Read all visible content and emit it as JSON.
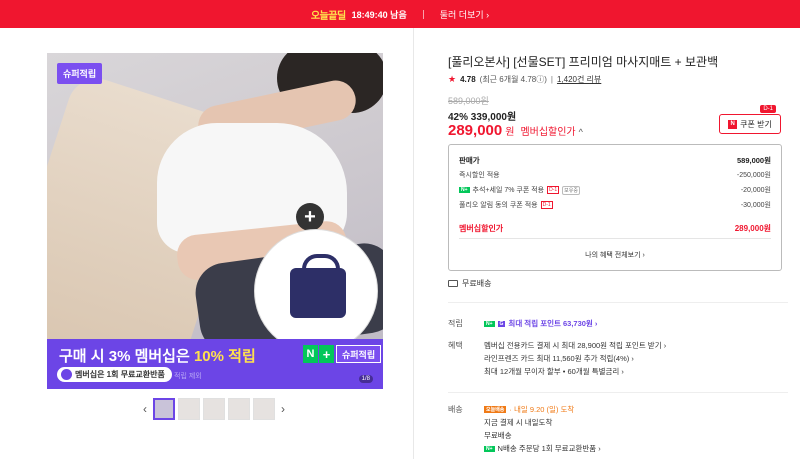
{
  "topbar": {
    "brand": "오늘끝딜",
    "time": "18:49:40 남음",
    "more": "둘러 더보기 ›"
  },
  "hero": {
    "tag": "슈퍼적립",
    "promo_headline_a": "구매 시 3% 멤버십은 ",
    "promo_headline_b": "10% 적립",
    "promo_sub": "멤버십은 1회 무료교환반품",
    "promo_faint": "적립 제외",
    "npay_label": "슈퍼적립",
    "counter": "1/8"
  },
  "thumbs": {
    "prev": "‹",
    "next": "›",
    "count": 5
  },
  "product": {
    "title": "[풀리오본사] [선물SET] 프리미엄 마사지매트 + 보관백",
    "rating_score": "4.78",
    "rating_detail": "(최근 6개월 4.78ⓘ)",
    "reviews": "1,420건 리뷰",
    "original_price": "589,000원",
    "discount_pct": "42%",
    "discount_price": "339,000원",
    "member_price": "289,000",
    "won": "원",
    "member_label": "멤버십할인가",
    "coupon": "쿠폰 받기",
    "coupon_tag": "D-1"
  },
  "price_box": {
    "sale_label": "판매가",
    "sale_value": "589,000원",
    "instant_label": "즉시할인 적용",
    "instant_value": "-250,000원",
    "extra_label": "추석+세일 7% 쿠폰 적용",
    "extra_tag": "D-1",
    "extra_tag2": "보유중",
    "extra_value": "-20,000원",
    "alarm_label": "풀리오 알림 동의 쿠폰 적용",
    "alarm_tag": "D-1",
    "alarm_value": "-30,000원",
    "member_label": "멤버십할인가",
    "member_value": "289,000원",
    "view_all": "나의 혜택 전체보기 ›"
  },
  "shipping": {
    "free": "무료배송"
  },
  "points": {
    "label": "적립",
    "value": "최대 적립 포인트 63,730원 ›"
  },
  "benefits": {
    "label": "혜택",
    "line1": "멤버십 전용카드 결제 시 최대 28,900원 적립 포인트 받기 ›",
    "line2": "라인프렌즈 카드 최대 11,560원 추가 적립(4%) ›",
    "line3": "최대 12개월 무이자 할부 • 60개월 특별금리 ›"
  },
  "delivery": {
    "label": "배송",
    "tag": "오늘배송",
    "line1": "· 내일 9.20 (일) 도착",
    "line2": "지금 결제 시 내일도착",
    "line3": "무료배송",
    "line4": "N배송 주문당 1회 무료교환반품 ›"
  },
  "colors": {
    "accent": "#f0162f",
    "member": "#6c45e6",
    "npay": "#03c75a"
  }
}
